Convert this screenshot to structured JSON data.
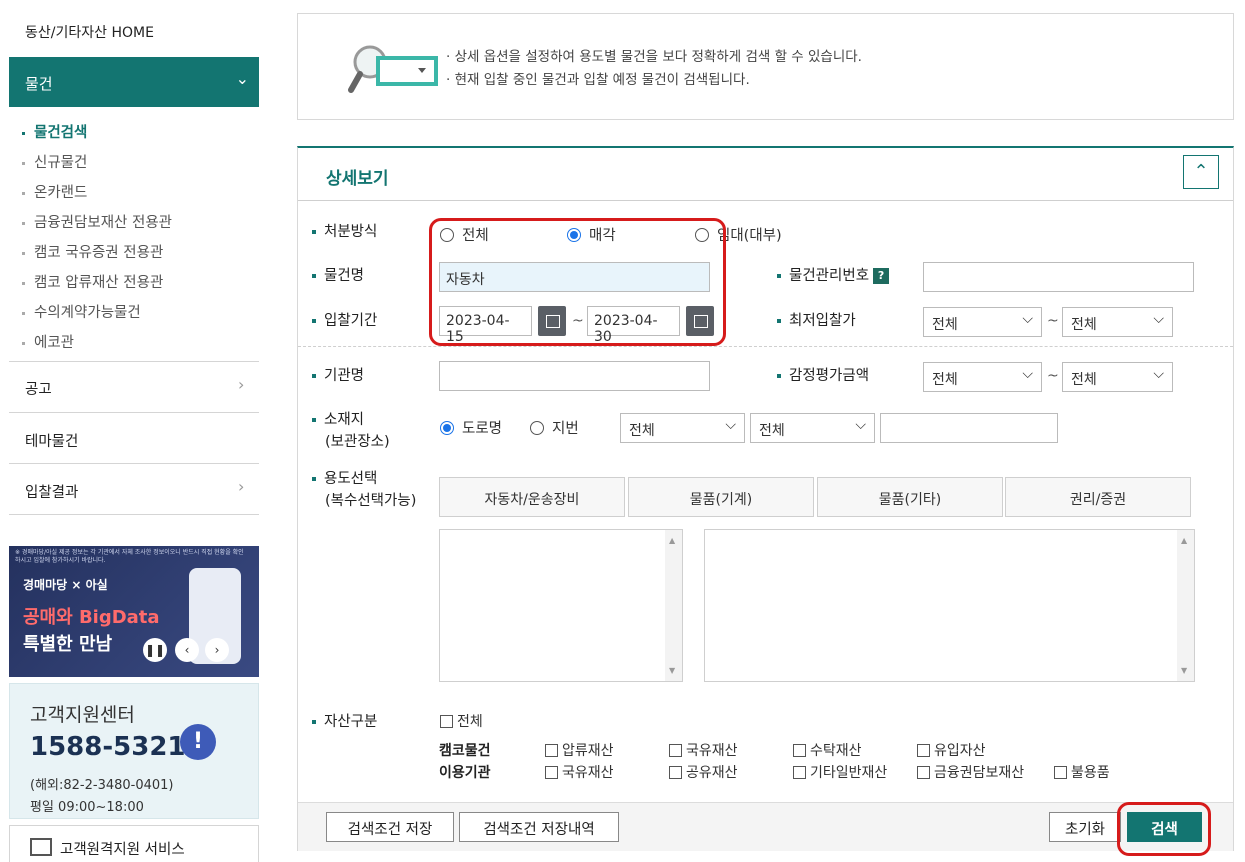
{
  "sidebar": {
    "home": "동산/기타자산 HOME",
    "active_menu": "물건",
    "sub_items": [
      "물건검색",
      "신규물건",
      "온카랜드",
      "금융권담보재산 전용관",
      "캠코 국유증권 전용관",
      "캠코 압류재산 전용관",
      "수의계약가능물건",
      "에코관"
    ],
    "menu_items": [
      "공고",
      "테마물건",
      "입찰결과"
    ],
    "banner": {
      "tiny_text": "※ 경매마당/아실 제공 정보는 각 기관에서 자체 조사한 정보이오니 반드시 직접 현황을 확인하시고 입찰에 참가하시기 바랍니다.",
      "brand": "경매마당 × 아실",
      "line1": "공매와 BigData",
      "line2": "특별한 만남"
    },
    "cs": {
      "title": "고객지원센터",
      "number": "1588-5321",
      "overseas": "(해외:82-2-3480-0401)",
      "hours": "평일 09:00~18:00"
    },
    "remote": "고객원격지원 서비스"
  },
  "info": {
    "line1": "· 상세 옵션을 설정하여 용도별 물건을 보다 정확하게 검색 할 수 있습니다.",
    "line2": "· 현재 입찰 중인 물건과 입찰 예정 물건이 검색됩니다."
  },
  "panel": {
    "title": "상세보기",
    "disposal": {
      "label": "처분방식",
      "options": [
        "전체",
        "매각",
        "임대(대부)"
      ],
      "selected": "매각"
    },
    "item_name": {
      "label": "물건명",
      "value": "자동차"
    },
    "mgmt_no": {
      "label": "물건관리번호",
      "help": "?"
    },
    "period": {
      "label": "입찰기간",
      "from": "2023-04-15",
      "to": "2023-04-30",
      "sep": "~"
    },
    "min_price": {
      "label": "최저입찰가",
      "from": "전체",
      "to": "전체",
      "sep": "~"
    },
    "org": {
      "label": "기관명"
    },
    "appraisal": {
      "label": "감정평가금액",
      "from": "전체",
      "to": "전체",
      "sep": "~"
    },
    "location": {
      "label1": "소재지",
      "label2": "(보관장소)",
      "options": [
        "도로명",
        "지번"
      ],
      "selected": "도로명",
      "sel1": "전체",
      "sel2": "전체"
    },
    "usage": {
      "label1": "용도선택",
      "label2": "(복수선택가능)",
      "tabs": [
        "자동차/운송장비",
        "물품(기계)",
        "물품(기타)",
        "권리/증권"
      ]
    },
    "asset": {
      "label": "자산구분",
      "all": "전체",
      "group1": "캠코물건",
      "group2": "이용기관",
      "row1": [
        "압류재산",
        "국유재산",
        "수탁재산",
        "유입자산"
      ],
      "row2": [
        "국유재산",
        "공유재산",
        "기타일반재산",
        "금융권담보재산",
        "불용품"
      ]
    },
    "buttons": {
      "save": "검색조건 저장",
      "history": "검색조건 저장내역",
      "reset": "초기화",
      "search": "검색"
    }
  }
}
